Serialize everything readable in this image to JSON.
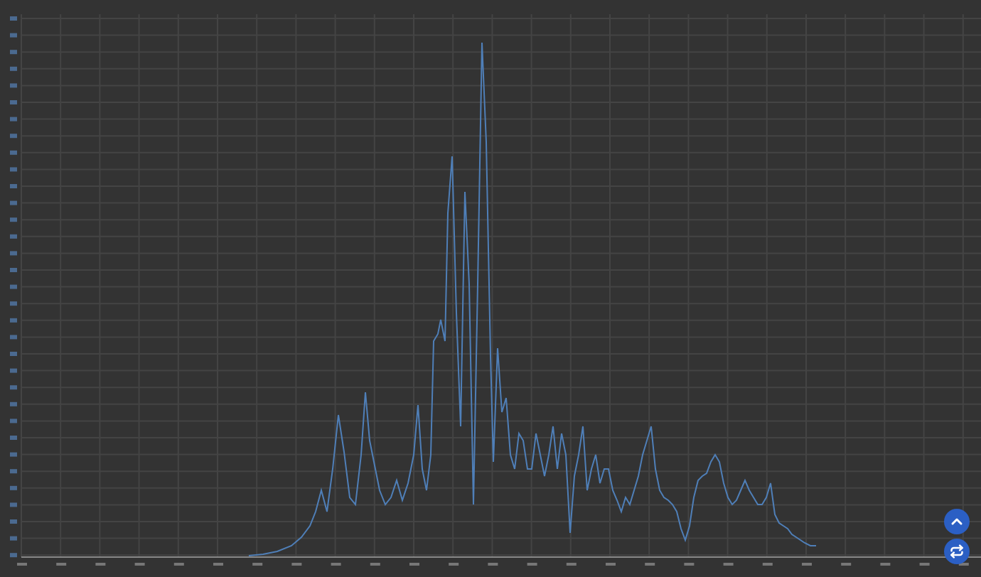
{
  "floating_buttons": [
    {
      "kind": "scroll-up"
    },
    {
      "kind": "repeat"
    }
  ]
}
